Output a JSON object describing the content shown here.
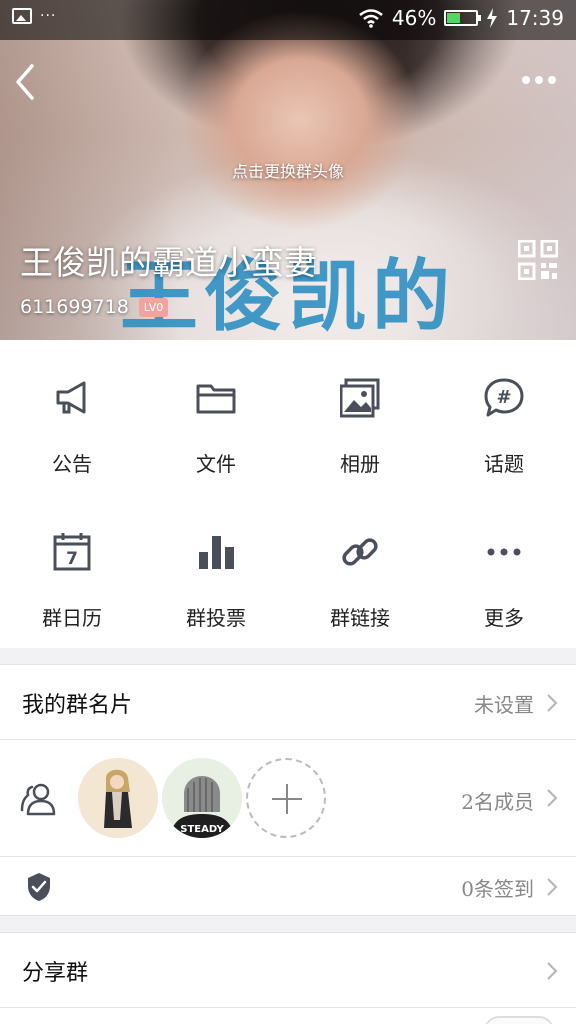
{
  "status_bar": {
    "battery": "46%",
    "time": "17:39",
    "dots": "···"
  },
  "header": {
    "avatar_hint": "点击更换群头像",
    "group_name": "王俊凯的霸道小蛮妻",
    "group_id": "611699718",
    "level_badge": "LV0",
    "cover_text": "王俊凯的"
  },
  "features": [
    {
      "label": "公告",
      "icon": "megaphone-icon"
    },
    {
      "label": "文件",
      "icon": "folder-icon"
    },
    {
      "label": "相册",
      "icon": "album-icon"
    },
    {
      "label": "话题",
      "icon": "topic-icon"
    },
    {
      "label": "群日历",
      "icon": "calendar-icon",
      "calendar_day": "7"
    },
    {
      "label": "群投票",
      "icon": "vote-chart-icon"
    },
    {
      "label": "群链接",
      "icon": "link-icon"
    },
    {
      "label": "更多",
      "icon": "more-dots-icon"
    }
  ],
  "card": {
    "title": "我的群名片",
    "value": "未设置"
  },
  "members": {
    "count_text": "2名成员",
    "avatar2_text": "STEADY"
  },
  "checkin": {
    "value": "0条签到"
  },
  "share": {
    "title": "分享群"
  },
  "colors": {
    "icon_gray": "#4a4f5a",
    "badge": "#f0a39f",
    "battery_green": "#4cd964"
  }
}
